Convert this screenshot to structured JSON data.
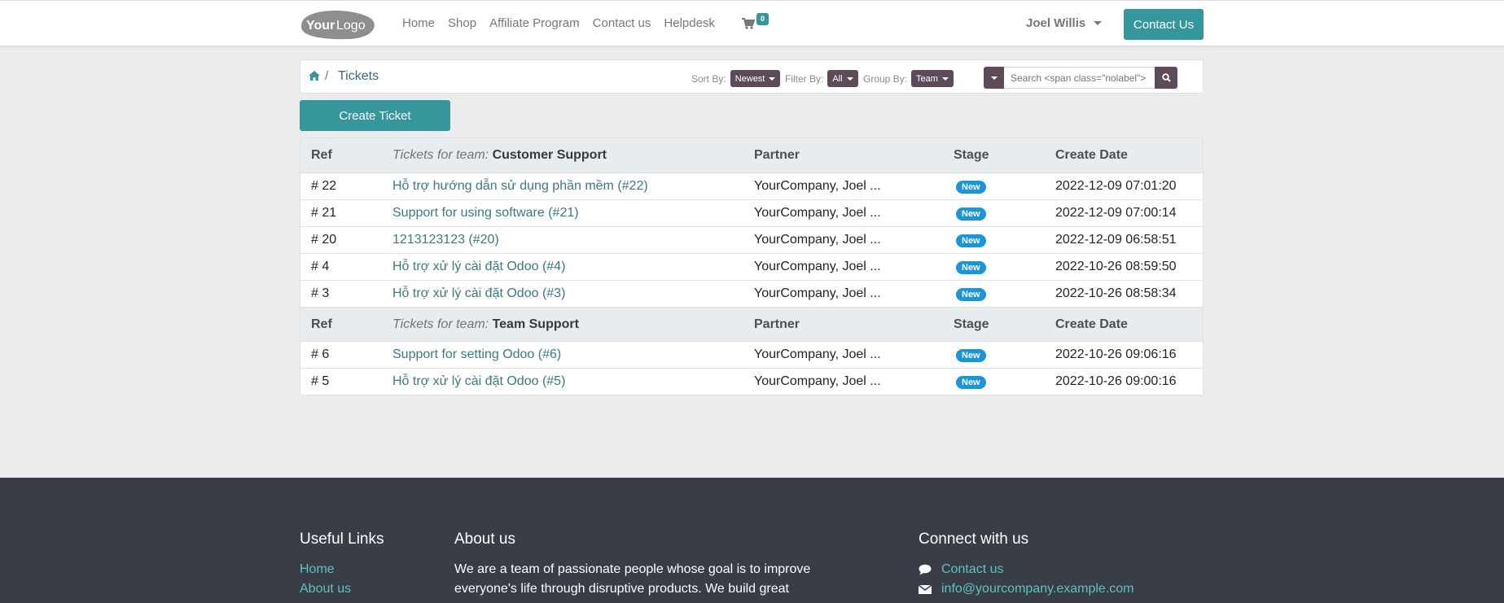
{
  "header": {
    "logo_text_bold": "Your",
    "logo_text_light": "Logo",
    "nav": [
      "Home",
      "Shop",
      "Affiliate Program",
      "Contact us",
      "Helpdesk"
    ],
    "cart_count": "0",
    "user_name": "Joel Willis",
    "contact_button": "Contact Us",
    "accent_color": "#35979c"
  },
  "breadcrumb": {
    "separator": "/",
    "current": "Tickets"
  },
  "controls": {
    "sort_label": "Sort By:",
    "sort_value": "Newest",
    "filter_label": "Filter By:",
    "filter_value": "All",
    "group_label": "Group By:",
    "group_value": "Team",
    "search_placeholder": "Search <span class=\"nolabel\"> i"
  },
  "create_button": "Create Ticket",
  "table": {
    "columns": {
      "ref": "Ref",
      "team_prefix": "Tickets for team:",
      "partner": "Partner",
      "stage": "Stage",
      "date": "Create Date"
    },
    "groups": [
      {
        "team": "Customer Support",
        "rows": [
          {
            "ref": "# 22",
            "name": "Hỗ trợ hướng dẫn sử dụng phần mềm (#22)",
            "partner": "YourCompany, Joel ...",
            "stage": "New",
            "date": "2022-12-09 07:01:20"
          },
          {
            "ref": "# 21",
            "name": "Support for using software (#21)",
            "partner": "YourCompany, Joel ...",
            "stage": "New",
            "date": "2022-12-09 07:00:14"
          },
          {
            "ref": "# 20",
            "name": "1213123123 (#20)",
            "partner": "YourCompany, Joel ...",
            "stage": "New",
            "date": "2022-12-09 06:58:51"
          },
          {
            "ref": "# 4",
            "name": "Hỗ trợ xử lý cài đặt Odoo (#4)",
            "partner": "YourCompany, Joel ...",
            "stage": "New",
            "date": "2022-10-26 08:59:50"
          },
          {
            "ref": "# 3",
            "name": "Hỗ trợ xử lý cài đặt Odoo (#3)",
            "partner": "YourCompany, Joel ...",
            "stage": "New",
            "date": "2022-10-26 08:58:34"
          }
        ]
      },
      {
        "team": "Team Support",
        "rows": [
          {
            "ref": "# 6",
            "name": "Support for setting Odoo (#6)",
            "partner": "YourCompany, Joel ...",
            "stage": "New",
            "date": "2022-10-26 09:06:16"
          },
          {
            "ref": "# 5",
            "name": "Hỗ trợ xử lý cài đặt Odoo (#5)",
            "partner": "YourCompany, Joel ...",
            "stage": "New",
            "date": "2022-10-26 09:00:16"
          }
        ]
      }
    ]
  },
  "footer": {
    "useful_links_title": "Useful Links",
    "useful_links": [
      "Home",
      "About us"
    ],
    "about_title": "About us",
    "about_text": "We are a team of passionate people whose goal is to improve everyone's life through disruptive products. We build great",
    "connect_title": "Connect with us",
    "connect_contact": "Contact us",
    "connect_email": "info@yourcompany.example.com"
  }
}
